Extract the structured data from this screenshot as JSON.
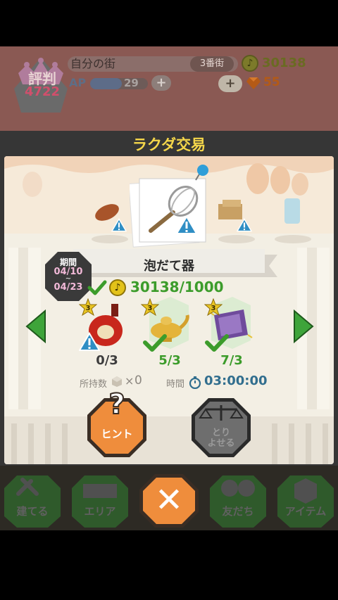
{
  "status": {
    "reputation_label": "評判",
    "reputation_value": "4722",
    "town_name": "自分の街",
    "town_area": "3番街",
    "coins": "30138",
    "ap_label": "AP",
    "ap_value": "29",
    "ap_fill_fraction": 0.55,
    "ap_plus": "+",
    "gem_plus": "+",
    "gems": "55"
  },
  "modal": {
    "title": "ラクダ交易",
    "item_name": "泡だて器",
    "period": {
      "label": "期間",
      "start": "04/10",
      "tilde": "~",
      "end": "04/23"
    },
    "requirement_text": "30138/1000",
    "materials": [
      {
        "count": "0/3",
        "level": "3",
        "ok": false
      },
      {
        "count": "5/3",
        "level": "3",
        "ok": true
      },
      {
        "count": "7/3",
        "level": "3",
        "ok": true
      }
    ],
    "owned_label": "所持数",
    "owned_sep": "×",
    "owned_value": "0",
    "time_label": "時間",
    "time_value": "03:00:00",
    "hint_label": "ヒント",
    "hint_glyph": "?",
    "trade_label_1": "とり",
    "trade_label_2": "よせる"
  },
  "nav": {
    "items": [
      {
        "label": "建てる"
      },
      {
        "label": "エリア"
      },
      {
        "label": "友だち"
      },
      {
        "label": "アイテム"
      }
    ],
    "close_glyph": "✕"
  },
  "colors": {
    "modal_title": "#f4d64a",
    "hint_orange": "#ef8d3c",
    "check_green": "#3c9c2b",
    "arrow_green": "#3ea43a"
  }
}
